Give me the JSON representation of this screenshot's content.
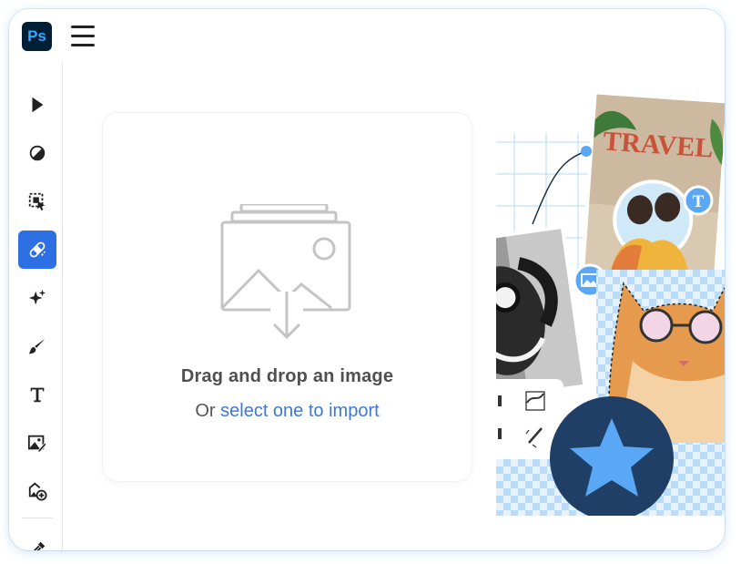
{
  "app": {
    "logo_text": "Ps",
    "menu_icon": "hamburger-icon"
  },
  "toolbar": {
    "tools": [
      {
        "name": "move-tool",
        "icon": "arrow-pointer-icon"
      },
      {
        "name": "adjust-tool",
        "icon": "contrast-circle-icon"
      },
      {
        "name": "selection-tool",
        "icon": "select-subject-icon"
      },
      {
        "name": "heal-tool",
        "icon": "bandage-icon",
        "active": true
      },
      {
        "name": "generative-tool",
        "icon": "sparkle-icon"
      },
      {
        "name": "brush-tool",
        "icon": "brush-icon"
      },
      {
        "name": "type-tool",
        "icon": "type-t-icon"
      },
      {
        "name": "image-edit-tool",
        "icon": "image-edit-icon"
      },
      {
        "name": "add-image-tool",
        "icon": "add-image-icon"
      },
      {
        "name": "eyedropper-tool",
        "icon": "eyedropper-icon"
      }
    ]
  },
  "drop_zone": {
    "title": "Drag and drop an image",
    "sub_prefix": "Or",
    "sub_link": "select one to import"
  },
  "collage": {
    "poster_text": "TRAVEL",
    "badge_text": "T"
  },
  "colors": {
    "accent": "#2f6fe4",
    "link": "#3b79d4",
    "ps_bg": "#001e36",
    "ps_fg": "#31a8ff",
    "star_bg": "#1f3f66",
    "star_fill": "#5aa8f5"
  }
}
